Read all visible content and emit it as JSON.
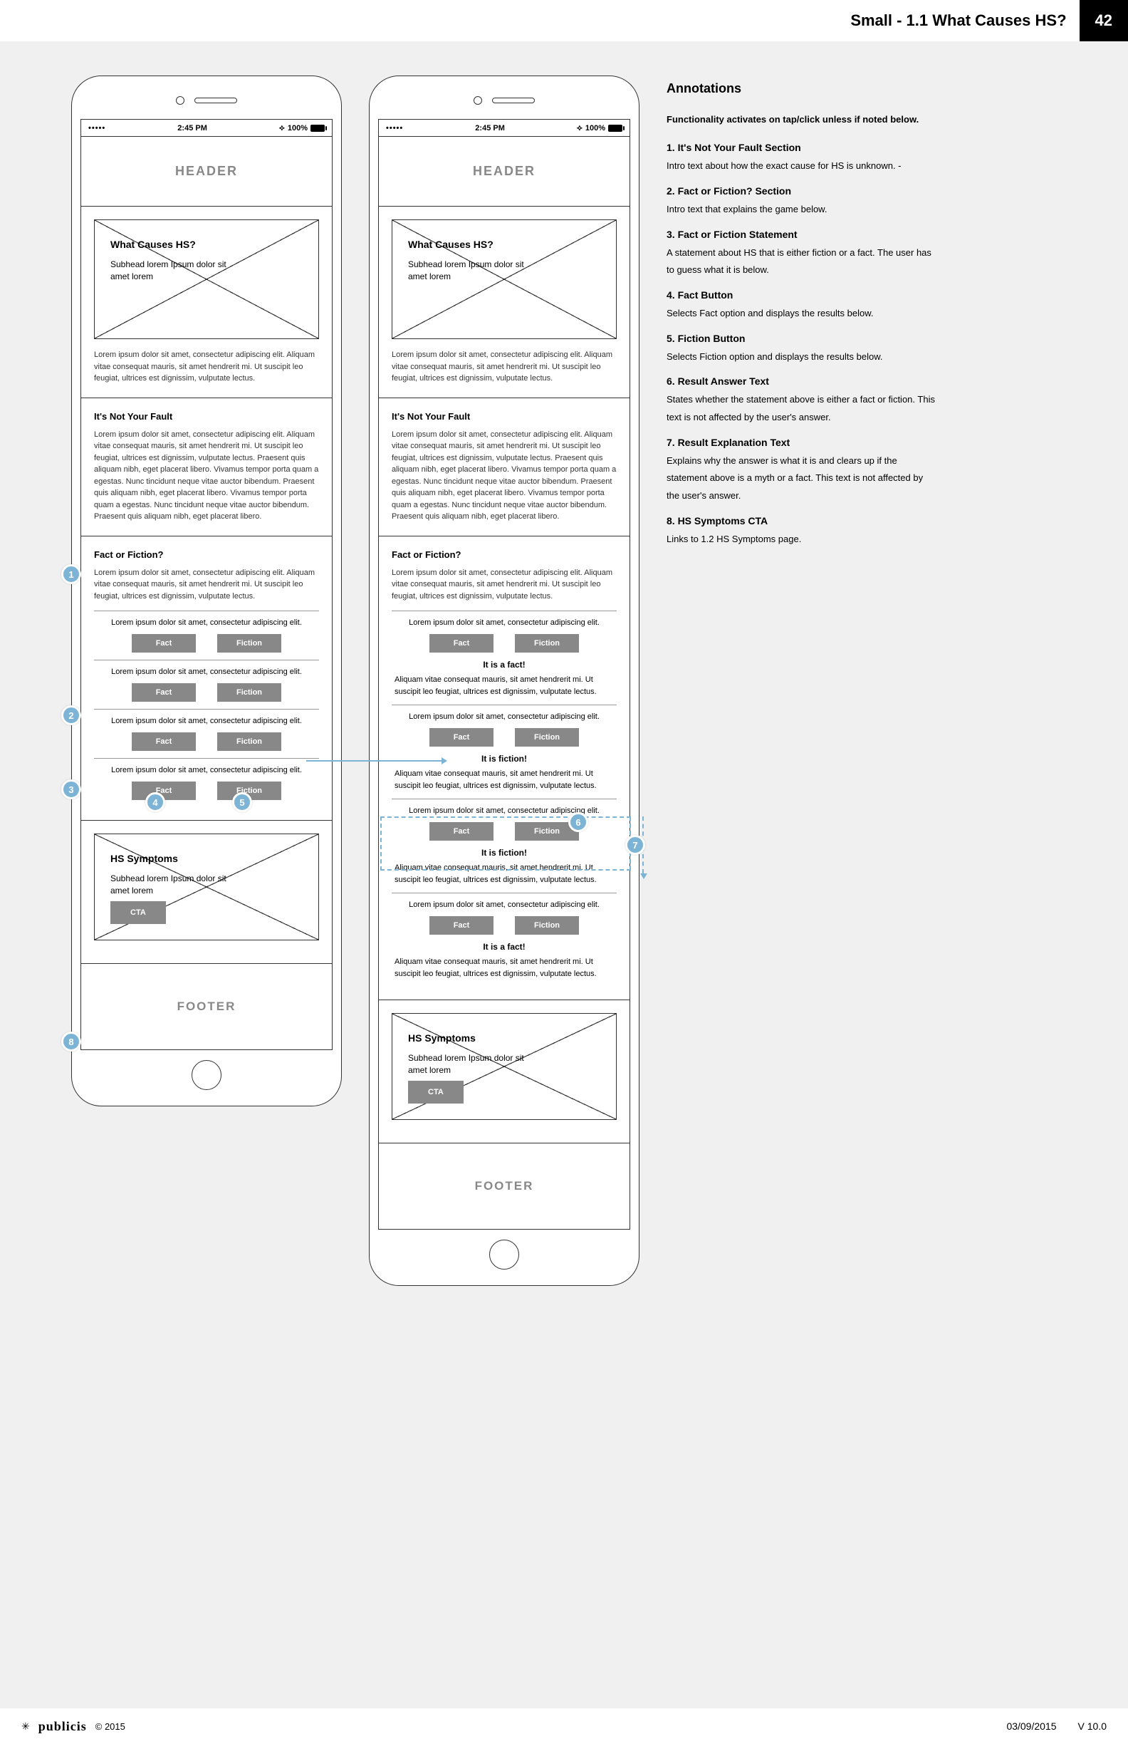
{
  "docHeader": {
    "title": "Small - 1.1 What Causes HS?",
    "pageNum": "42"
  },
  "statusbar": {
    "dots": "•••••",
    "time": "2:45 PM",
    "battery": "100%"
  },
  "labels": {
    "header": "HEADER",
    "footer": "FOOTER",
    "fact": "Fact",
    "fiction": "Fiction",
    "cta": "CTA"
  },
  "hero": {
    "title": "What Causes HS?",
    "sub": "Subhead lorem Ipsum dolor sit amet lorem",
    "body": "Lorem ipsum dolor sit amet, consectetur adipiscing elit. Aliquam vitae consequat mauris, sit amet hendrerit mi. Ut suscipit leo feugiat, ultrices est dignissim, vulputate lectus."
  },
  "notFault": {
    "title": "It's Not Your Fault",
    "body": "Lorem ipsum dolor sit amet, consectetur adipiscing elit. Aliquam vitae consequat mauris, sit amet hendrerit mi. Ut suscipit leo feugiat, ultrices est dignissim, vulputate lectus. Praesent quis aliquam nibh, eget placerat libero. Vivamus tempor porta quam a egestas. Nunc tincidunt neque vitae auctor bibendum. Praesent quis aliquam nibh, eget placerat libero. Vivamus tempor porta quam a egestas. Nunc tincidunt neque vitae auctor bibendum. Praesent quis aliquam nibh, eget placerat libero."
  },
  "game": {
    "title": "Fact or Fiction?",
    "intro": "Lorem ipsum dolor sit amet, consectetur adipiscing elit. Aliquam vitae consequat mauris, sit amet hendrerit mi. Ut suscipit leo feugiat, ultrices est dignissim, vulputate lectus.",
    "statement": "Lorem ipsum dolor sit amet, consectetur adipiscing elit.",
    "resultFact": "It is a fact!",
    "resultFiction": "It is fiction!",
    "resultBody": "Aliquam vitae consequat mauris, sit amet hendrerit mi. Ut suscipit leo feugiat, ultrices est dignissim, vulputate lectus."
  },
  "symptoms": {
    "title": "HS Symptoms",
    "sub": "Subhead lorem Ipsum dolor sit amet lorem"
  },
  "annotations": {
    "heading": "Annotations",
    "intro": "Functionality activates on tap/click unless if noted below.",
    "items": [
      {
        "t": "1. It's Not Your Fault Section",
        "b": "Intro text about how the exact cause for HS is unknown.\n-"
      },
      {
        "t": "2. Fact or Fiction? Section",
        "b": "Intro text that explains the game below."
      },
      {
        "t": "3. Fact or Fiction Statement",
        "b": "A statement about HS that is either fiction or a fact. The user has to guess what it is below."
      },
      {
        "t": "4. Fact Button",
        "b": "Selects Fact option and displays the results below."
      },
      {
        "t": "5. Fiction Button",
        "b": "Selects Fiction option and displays the results below."
      },
      {
        "t": "6. Result Answer Text",
        "b": "States whether the statement above is either a fact or fiction. This text is not affected by the user's answer."
      },
      {
        "t": "7. Result Explanation Text",
        "b": "Explains why the answer is what it is and clears up if the statement above is a myth or a fact. This text is not affected by the user's answer."
      },
      {
        "t": "8. HS Symptoms CTA",
        "b": "Links to 1.2 HS Symptoms page."
      }
    ]
  },
  "docFooter": {
    "brand": "publicis",
    "copy": "© 2015",
    "date": "03/09/2015",
    "version": "V 10.0"
  }
}
